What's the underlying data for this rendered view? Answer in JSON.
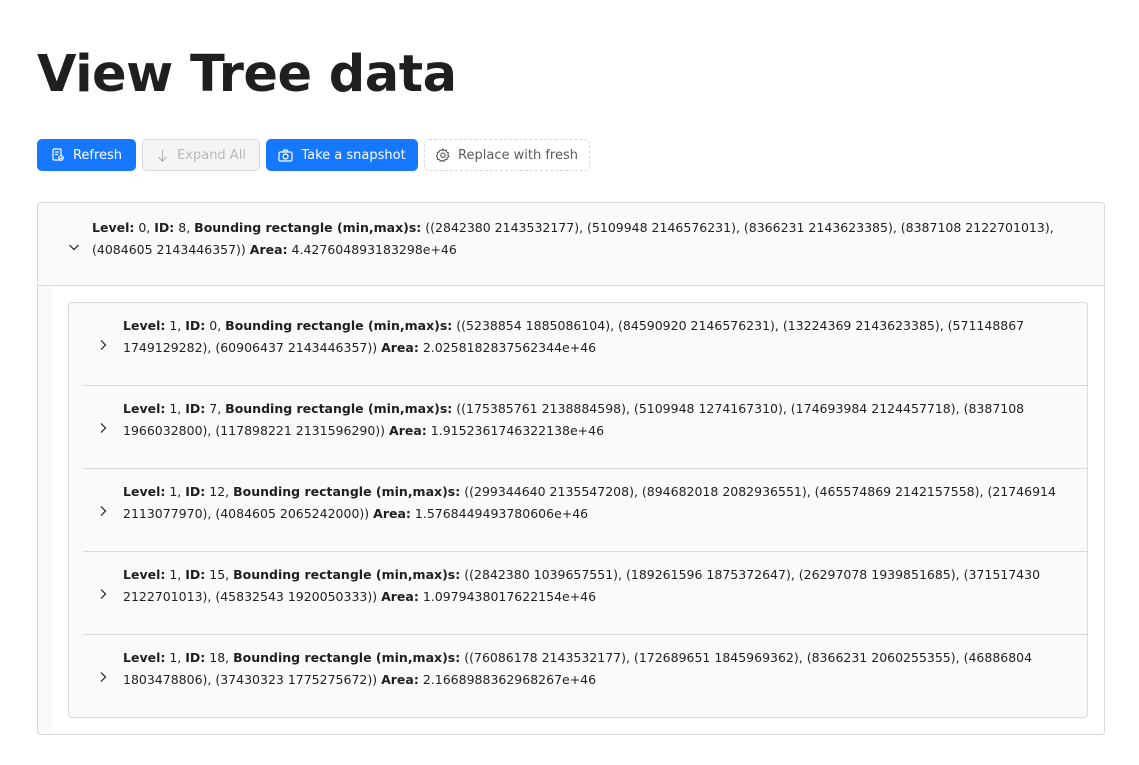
{
  "page": {
    "title": "View Tree data"
  },
  "toolbar": {
    "refresh_label": "Refresh",
    "expand_all_label": "Expand All",
    "snapshot_label": "Take a snapshot",
    "replace_label": "Replace with fresh"
  },
  "colors": {
    "primary": "#1677ff",
    "border": "#d9d9d9",
    "panel_bg": "#fafafa"
  },
  "labels": {
    "level": "Level:",
    "id": "ID:",
    "bounding": "Bounding rectangle (min,max)s:",
    "area": "Area:"
  },
  "tree": {
    "root": {
      "level": "0",
      "id": "8",
      "bounding": "((2842380 2143532177), (5109948 2146576231), (8366231 2143623385), (8387108 2122701013), (4084605 2143446357))",
      "area": "4.427604893183298e+46",
      "expanded": true
    },
    "children": [
      {
        "level": "1",
        "id": "0",
        "bounding": "((5238854 1885086104), (84590920 2146576231), (13224369 2143623385), (571148867 1749129282), (60906437 2143446357))",
        "area": "2.0258182837562344e+46"
      },
      {
        "level": "1",
        "id": "7",
        "bounding": "((175385761 2138884598), (5109948 1274167310), (174693984 2124457718), (8387108 1966032800), (117898221 2131596290))",
        "area": "1.9152361746322138e+46"
      },
      {
        "level": "1",
        "id": "12",
        "bounding": "((299344640 2135547208), (894682018 2082936551), (465574869 2142157558), (21746914 2113077970), (4084605 2065242000))",
        "area": "1.5768449493780606e+46"
      },
      {
        "level": "1",
        "id": "15",
        "bounding": "((2842380 1039657551), (189261596 1875372647), (26297078 1939851685), (371517430 2122701013), (45832543 1920050333))",
        "area": "1.0979438017622154e+46"
      },
      {
        "level": "1",
        "id": "18",
        "bounding": "((76086178 2143532177), (172689651 1845969362), (8366231 2060255355), (46886804 1803478806), (37430323 1775275672))",
        "area": "2.1668988362968267e+46"
      }
    ]
  }
}
